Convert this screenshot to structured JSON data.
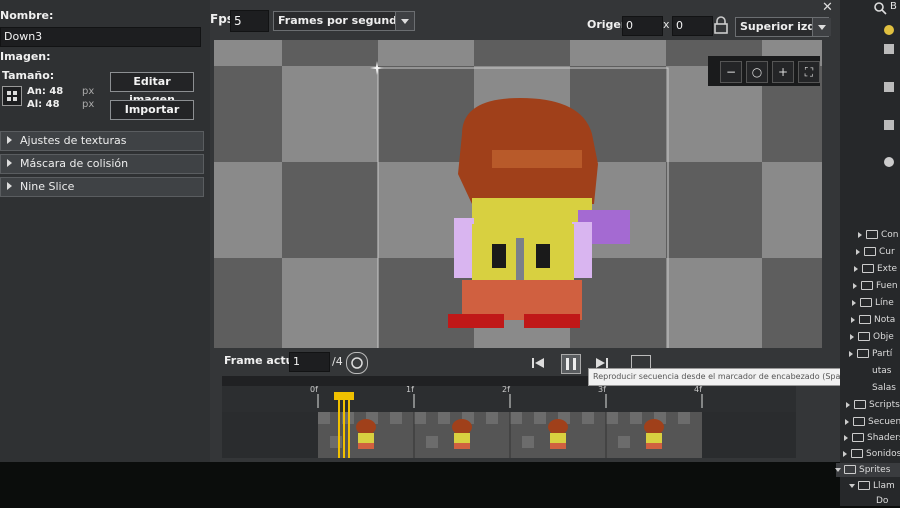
{
  "left": {
    "name_label": "Nombre:",
    "name_value": "Down3",
    "image_label": "Imagen:",
    "size_label": "Tamaño:",
    "width_label": "An: 48",
    "height_label": "Al: 48",
    "unit": "px",
    "edit_image": "Editar imagen",
    "import": "Importar",
    "sections": [
      "Ajustes de texturas",
      "Máscara de colisión",
      "Nine Slice"
    ]
  },
  "toolbar": {
    "fps_label": "Fps",
    "fps_value": "5",
    "fps_mode": "Frames por segundo",
    "origin_label": "Origen",
    "origin_x": "0",
    "origin_sep": "x",
    "origin_y": "0",
    "origin_preset": "Superior izquier"
  },
  "playback": {
    "frame_label": "Frame actual:",
    "frame_value": "1",
    "frame_total": "/4"
  },
  "timeline": {
    "markers": [
      "0f",
      "1f",
      "2f",
      "3f",
      "4f"
    ]
  },
  "tooltip": "Reproducir secuencia desde el marcador de encabezado (Space)",
  "right": {
    "search_label": "B",
    "items": [
      "Con",
      "Cur",
      "Exte",
      "Fuen",
      "Líne",
      "Nota",
      "Obje",
      "Partí",
      "utas",
      "Salas",
      "Scripts",
      "Secuen",
      "Shaders",
      "Sonidos",
      "Sprites",
      "Llam",
      "Do"
    ]
  },
  "colors": {
    "accent": "#f0c000",
    "hair": "#a0401a",
    "jacket": "#d8d040",
    "pants": "#d06040"
  }
}
